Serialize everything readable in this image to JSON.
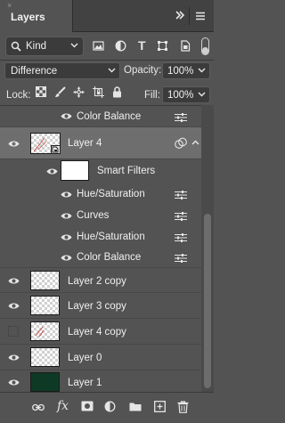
{
  "panel": {
    "title": "Layers",
    "close_glyph": "×",
    "collapse_icon": "double-chevron-right-icon",
    "menu_icon": "hamburger-menu-icon"
  },
  "filter": {
    "kind_label": "Kind",
    "search_icon": "search-icon",
    "icons": [
      "pixel-layer-filter-icon",
      "adjustment-layer-filter-icon",
      "type-layer-filter-icon",
      "shape-layer-filter-icon",
      "smart-object-filter-icon"
    ],
    "type_glyph": "T",
    "toggle_on": true
  },
  "blend": {
    "mode": "Difference",
    "opacity_label": "Opacity:",
    "opacity_value": "100%"
  },
  "lock": {
    "label": "Lock:",
    "icons": [
      "lock-transparent-pixels-icon",
      "lock-image-pixels-icon",
      "lock-position-icon",
      "lock-artboard-icon",
      "lock-all-icon"
    ],
    "fill_label": "Fill:",
    "fill_value": "100%"
  },
  "layers": {
    "top_effect": {
      "name": "Color Balance",
      "visible": true
    },
    "layer4": {
      "name": "Layer 4",
      "visible": true,
      "selected": true,
      "has_smart_filters": true
    },
    "smart_filters": {
      "label": "Smart Filters",
      "visible": true,
      "items": [
        {
          "name": "Hue/Saturation",
          "visible": true
        },
        {
          "name": "Curves",
          "visible": true
        },
        {
          "name": "Hue/Saturation",
          "visible": true
        },
        {
          "name": "Color Balance",
          "visible": true
        }
      ]
    },
    "list": [
      {
        "name": "Layer 2 copy",
        "visible": true,
        "thumb": "transparent"
      },
      {
        "name": "Layer 3 copy",
        "visible": true,
        "thumb": "transparent"
      },
      {
        "name": "Layer 4 copy",
        "visible": false,
        "thumb": "transparent-red-mark"
      },
      {
        "name": "Layer 0",
        "visible": true,
        "thumb": "transparent"
      },
      {
        "name": "Layer 1",
        "visible": true,
        "thumb": "dark-green"
      }
    ]
  },
  "toolbar": {
    "fx_label": "fx",
    "icons": [
      "link-layers-icon",
      "add-layer-style-icon",
      "add-mask-icon",
      "new-adjustment-layer-icon",
      "new-group-icon",
      "new-layer-icon",
      "delete-layer-icon"
    ]
  },
  "colors": {
    "panel_bg": "#535353",
    "header_bg": "#424242",
    "selected_row": "#6e6e6e",
    "layer1_fill": "#0e3a25",
    "thumb_mark": "#c0392b"
  }
}
